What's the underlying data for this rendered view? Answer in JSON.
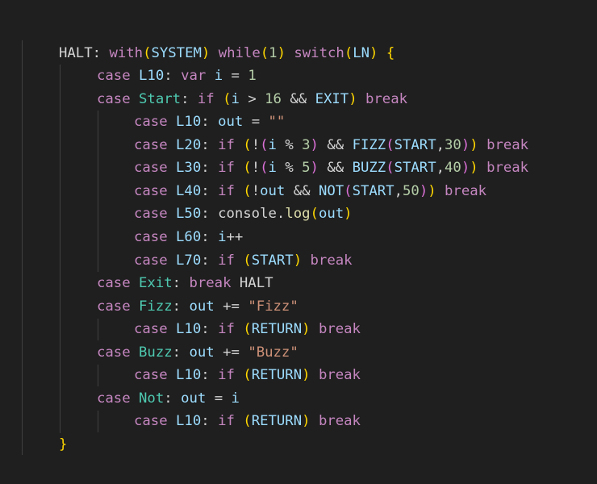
{
  "code": {
    "lines": [
      "HALT: with(SYSTEM) while(1) switch(LN) {",
      "case L10: var i = 1",
      "case Start: if (i > 16 && EXIT) break",
      "case L10: out = \"\"",
      "case L20: if (!(i % 3) && FIZZ(START,30)) break",
      "case L30: if (!(i % 5) && BUZZ(START,40)) break",
      "case L40: if (!out && NOT(START,50)) break",
      "case L50: console.log(out)",
      "case L60: i++",
      "case L70: if (START) break",
      "case Exit: break HALT",
      "case Fizz: out += \"Fizz\"",
      "case L10: if (RETURN) break",
      "case Buzz: out += \"Buzz\"",
      "case L10: if (RETURN) break",
      "case Not: out = i",
      "case L10: if (RETURN) break",
      "}"
    ]
  },
  "theme": {
    "background": "#1f1f1f",
    "keyword": "#c586c0",
    "variable": "#9cdcfe",
    "label": "#4ec9b0",
    "function": "#dcdcaa",
    "number": "#b5cea8",
    "string": "#ce9178",
    "bracket_1": "#ffd700",
    "bracket_2": "#da70d6",
    "bracket_3": "#179fff",
    "indent_guide": "#404040"
  }
}
